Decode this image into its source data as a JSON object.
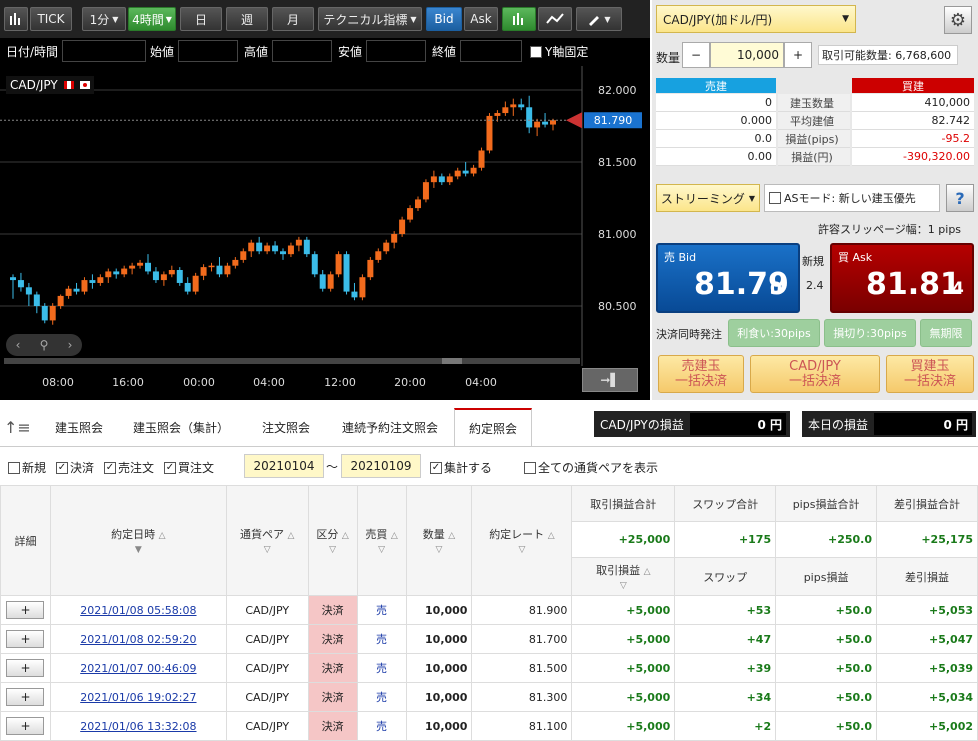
{
  "toolbar": {
    "tick": "TICK",
    "interval1": "1分",
    "interval2": "4時間",
    "day": "日",
    "week": "週",
    "month": "月",
    "technical": "テクニカル指標",
    "bid": "Bid",
    "ask": "Ask"
  },
  "fields": {
    "datetime": "日付/時間",
    "open": "始値",
    "high": "高値",
    "low": "安値",
    "close": "終値",
    "yfix": "Y軸固定"
  },
  "chart_data": {
    "type": "candlestick",
    "pair": "CAD/JPY",
    "y_ticks": [
      "82.000",
      "81.500",
      "81.000",
      "80.500"
    ],
    "x_ticks": [
      "08:00",
      "16:00",
      "00:00",
      "04:00",
      "12:00",
      "20:00",
      "04:00"
    ],
    "current_price": "81.790",
    "candles": [
      [
        80.7,
        80.72,
        80.55,
        80.68
      ],
      [
        80.68,
        80.73,
        80.6,
        80.63
      ],
      [
        80.63,
        80.66,
        80.5,
        80.58
      ],
      [
        80.58,
        80.6,
        80.45,
        80.5
      ],
      [
        80.5,
        80.52,
        80.38,
        80.4
      ],
      [
        80.4,
        80.52,
        80.37,
        80.5
      ],
      [
        80.5,
        80.58,
        80.48,
        80.57
      ],
      [
        80.57,
        80.64,
        80.55,
        80.62
      ],
      [
        80.62,
        80.66,
        80.58,
        80.6
      ],
      [
        80.6,
        80.7,
        80.58,
        80.68
      ],
      [
        80.68,
        80.72,
        80.62,
        80.66
      ],
      [
        80.66,
        80.72,
        80.64,
        80.7
      ],
      [
        80.7,
        80.76,
        80.66,
        80.74
      ],
      [
        80.74,
        80.76,
        80.69,
        80.72
      ],
      [
        80.72,
        80.78,
        80.7,
        80.76
      ],
      [
        80.76,
        80.8,
        80.72,
        80.78
      ],
      [
        80.78,
        80.82,
        80.76,
        80.8
      ],
      [
        80.8,
        80.86,
        80.72,
        80.74
      ],
      [
        80.74,
        80.77,
        80.66,
        80.68
      ],
      [
        80.68,
        80.74,
        80.64,
        80.72
      ],
      [
        80.72,
        80.78,
        80.7,
        80.75
      ],
      [
        80.75,
        80.77,
        80.64,
        80.66
      ],
      [
        80.66,
        80.7,
        80.58,
        80.6
      ],
      [
        80.6,
        80.73,
        80.58,
        80.71
      ],
      [
        80.71,
        80.79,
        80.68,
        80.77
      ],
      [
        80.77,
        80.8,
        80.74,
        80.78
      ],
      [
        80.78,
        80.84,
        80.7,
        80.72
      ],
      [
        80.72,
        80.8,
        80.7,
        80.78
      ],
      [
        80.78,
        80.84,
        80.76,
        80.82
      ],
      [
        80.82,
        80.9,
        80.8,
        80.88
      ],
      [
        80.88,
        80.96,
        80.84,
        80.94
      ],
      [
        80.94,
        80.98,
        80.86,
        80.88
      ],
      [
        80.88,
        80.94,
        80.86,
        80.92
      ],
      [
        80.92,
        80.95,
        80.86,
        80.88
      ],
      [
        80.88,
        80.9,
        80.82,
        80.86
      ],
      [
        80.86,
        80.94,
        80.84,
        80.92
      ],
      [
        80.92,
        80.98,
        80.88,
        80.96
      ],
      [
        80.96,
        80.98,
        80.84,
        80.86
      ],
      [
        80.86,
        80.88,
        80.7,
        80.72
      ],
      [
        80.72,
        80.75,
        80.6,
        80.62
      ],
      [
        80.62,
        80.74,
        80.6,
        80.72
      ],
      [
        80.72,
        80.88,
        80.7,
        80.86
      ],
      [
        80.86,
        80.88,
        80.58,
        80.6
      ],
      [
        80.6,
        80.66,
        80.54,
        80.56
      ],
      [
        80.56,
        80.72,
        80.54,
        80.7
      ],
      [
        80.7,
        80.84,
        80.68,
        80.82
      ],
      [
        80.82,
        80.9,
        80.8,
        80.88
      ],
      [
        80.88,
        80.96,
        80.86,
        80.94
      ],
      [
        80.94,
        81.02,
        80.9,
        81.0
      ],
      [
        81.0,
        81.12,
        80.98,
        81.1
      ],
      [
        81.1,
        81.2,
        81.08,
        81.18
      ],
      [
        81.18,
        81.26,
        81.16,
        81.24
      ],
      [
        81.24,
        81.38,
        81.22,
        81.36
      ],
      [
        81.36,
        81.44,
        81.32,
        81.4
      ],
      [
        81.4,
        81.42,
        81.34,
        81.36
      ],
      [
        81.36,
        81.42,
        81.34,
        81.4
      ],
      [
        81.4,
        81.46,
        81.38,
        81.44
      ],
      [
        81.44,
        81.5,
        81.4,
        81.42
      ],
      [
        81.42,
        81.48,
        81.4,
        81.46
      ],
      [
        81.46,
        81.6,
        81.44,
        81.58
      ],
      [
        81.58,
        81.84,
        81.56,
        81.82
      ],
      [
        81.82,
        81.86,
        81.78,
        81.84
      ],
      [
        81.84,
        81.92,
        81.82,
        81.88
      ],
      [
        81.88,
        81.94,
        81.82,
        81.9
      ],
      [
        81.9,
        81.94,
        81.86,
        81.88
      ],
      [
        81.88,
        81.96,
        81.7,
        81.74
      ],
      [
        81.74,
        81.8,
        81.68,
        81.78
      ],
      [
        81.78,
        81.84,
        81.74,
        81.76
      ],
      [
        81.76,
        81.8,
        81.72,
        81.79
      ]
    ]
  },
  "order_panel": {
    "pair_select": "CAD/JPY(加ドル/円)",
    "qty_label": "数量",
    "qty_value": "10,000",
    "available_label": "取引可能数量: 6,768,600",
    "sell_header": "売建",
    "buy_header": "買建",
    "rows": [
      {
        "label": "建玉数量",
        "sell": "0",
        "buy": "410,000"
      },
      {
        "label": "平均建値",
        "sell": "0.000",
        "buy": "82.742"
      },
      {
        "label": "損益(pips)",
        "sell": "0.0",
        "buy": "-95.2"
      },
      {
        "label": "損益(円)",
        "sell": "0.00",
        "buy": "-390,320.00"
      }
    ],
    "streaming": "ストリーミング",
    "as_mode": "ASモード: 新しい建玉優先",
    "help": "?",
    "slippage": "許容スリッページ幅：1 pips",
    "sell_bid_label": "売 Bid",
    "sell_bid_big": "81.79",
    "sell_bid_small": "0",
    "new_label": "新規",
    "spread": "2.4",
    "buy_ask_label": "買 Ask",
    "buy_ask_big": "81.81",
    "buy_ask_small": "4",
    "settle_label": "決済同時発注",
    "take_profit": "利食い:30pips",
    "stop_loss": "損切り:30pips",
    "unlimited": "無期限",
    "btn_sell_settle_1": "売建玉",
    "btn_sell_settle_2": "一括決済",
    "btn_pair_settle_1": "CAD/JPY",
    "btn_pair_settle_2": "一括決済",
    "btn_buy_settle_1": "買建玉",
    "btn_buy_settle_2": "一括決済"
  },
  "tabs": [
    "建玉照会",
    "建玉照会（集計）",
    "注文照会",
    "連続予約注文照会",
    "約定照会"
  ],
  "pl_boxes": {
    "pair_pl_label": "CAD/JPYの損益",
    "pair_pl_value": "0 円",
    "today_pl_label": "本日の損益",
    "today_pl_value": "0 円"
  },
  "filters": {
    "new": "新規",
    "settle": "決済",
    "sell_order": "売注文",
    "buy_order": "買注文",
    "date_from": "20210104",
    "tilde": "～",
    "date_to": "20210109",
    "aggregate": "集計する",
    "all_pairs": "全ての通貨ペアを表示"
  },
  "table": {
    "headers": [
      "詳細",
      "約定日時",
      "通貨ペア",
      "区分",
      "売買",
      "数量",
      "約定レート"
    ],
    "sum_headers": [
      "取引損益合計",
      "スワップ合計",
      "pips損益合計",
      "差引損益合計"
    ],
    "sum_values": [
      "+25,000",
      "+175",
      "+250.0",
      "+25,175"
    ],
    "sub_headers": [
      "取引損益",
      "スワップ",
      "pips損益",
      "差引損益"
    ],
    "rows": [
      {
        "date": "2021/01/08 05:58:08",
        "pair": "CAD/JPY",
        "kind": "決済",
        "side": "売",
        "qty": "10,000",
        "rate": "81.900",
        "pl": "+5,000",
        "swap": "+53",
        "pips": "+50.0",
        "net": "+5,053"
      },
      {
        "date": "2021/01/08 02:59:20",
        "pair": "CAD/JPY",
        "kind": "決済",
        "side": "売",
        "qty": "10,000",
        "rate": "81.700",
        "pl": "+5,000",
        "swap": "+47",
        "pips": "+50.0",
        "net": "+5,047"
      },
      {
        "date": "2021/01/07 00:46:09",
        "pair": "CAD/JPY",
        "kind": "決済",
        "side": "売",
        "qty": "10,000",
        "rate": "81.500",
        "pl": "+5,000",
        "swap": "+39",
        "pips": "+50.0",
        "net": "+5,039"
      },
      {
        "date": "2021/01/06 19:02:27",
        "pair": "CAD/JPY",
        "kind": "決済",
        "side": "売",
        "qty": "10,000",
        "rate": "81.300",
        "pl": "+5,000",
        "swap": "+34",
        "pips": "+50.0",
        "net": "+5,034"
      },
      {
        "date": "2021/01/06 13:32:08",
        "pair": "CAD/JPY",
        "kind": "決済",
        "side": "売",
        "qty": "10,000",
        "rate": "81.100",
        "pl": "+5,000",
        "swap": "+2",
        "pips": "+50.0",
        "net": "+5,002"
      }
    ]
  },
  "colors": {
    "up": "#f26b1d",
    "down": "#3bbce8",
    "sell": "#0a57b0",
    "buy": "#b00000"
  }
}
